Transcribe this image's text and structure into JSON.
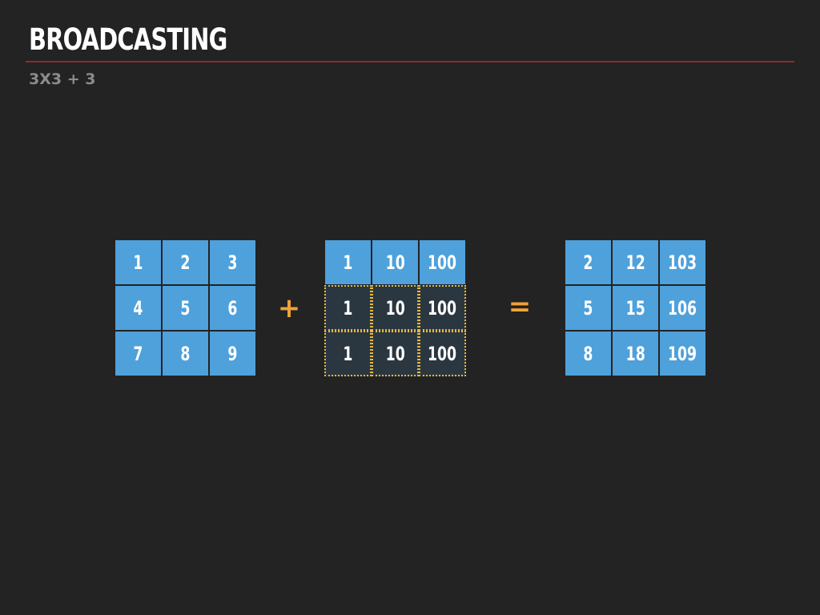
{
  "slide": {
    "title": "BROADCASTING",
    "subtitle": "3X3 + 3",
    "colors": {
      "background": "#232323",
      "rule": "#8a2c2c",
      "cell": "#4ea1db",
      "broadcast_cell": "#2b3740",
      "broadcast_border": "#e8b93e",
      "operator": "#f0a33a"
    }
  },
  "equation": {
    "matrix_a": [
      [
        "1",
        "2",
        "3"
      ],
      [
        "4",
        "5",
        "6"
      ],
      [
        "7",
        "8",
        "9"
      ]
    ],
    "plus": "+",
    "vector_b": [
      [
        "1",
        "10",
        "100"
      ],
      [
        "1",
        "10",
        "100"
      ],
      [
        "1",
        "10",
        "100"
      ]
    ],
    "equals": "=",
    "result": [
      [
        "2",
        "12",
        "103"
      ],
      [
        "5",
        "15",
        "106"
      ],
      [
        "8",
        "18",
        "109"
      ]
    ]
  }
}
